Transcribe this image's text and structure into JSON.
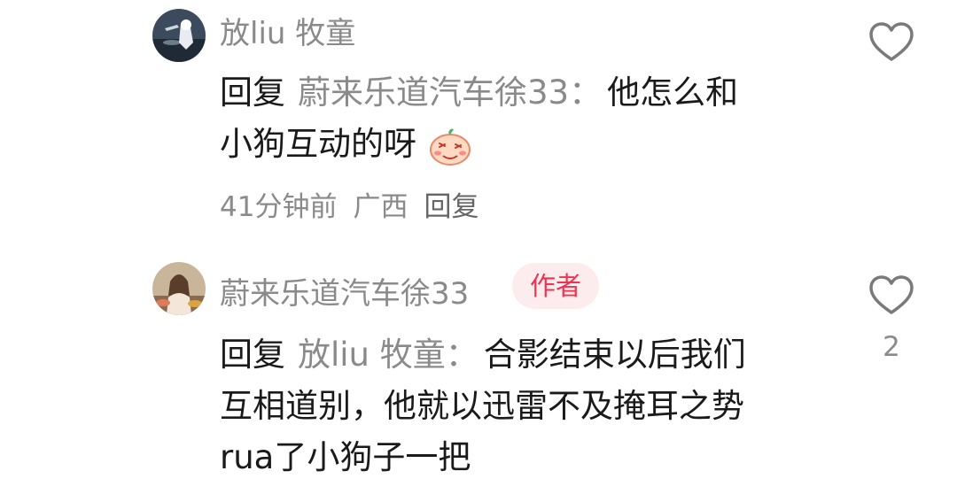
{
  "comments": [
    {
      "username": "放liu 牧童",
      "reply_word": "回复",
      "reply_target": "蔚来乐道汽车徐33",
      "colon": "：",
      "text_line1": "他怎么和",
      "text_line2": "小狗互动的呀",
      "emoji_icon": "shy-blush-emoji-icon",
      "time": "41分钟前",
      "location": "广西",
      "reply_label": "回复",
      "like_icon": "heart-outline-icon"
    },
    {
      "username": "蔚来乐道汽车徐33",
      "author_badge": "作者",
      "reply_word": "回复",
      "reply_target": "放liu 牧童",
      "colon": "：",
      "text_line1": "合影结束以后我们",
      "text_line2": "互相道别，他就以迅雷不及掩耳之势",
      "text_line3": "rua了小狗子一把",
      "like_icon": "heart-outline-icon",
      "like_count": "2"
    }
  ],
  "colors": {
    "username": "#8a8a8a",
    "text": "#1a1a1a",
    "author_badge_bg": "#fdecee",
    "author_badge_text": "#f0324e"
  }
}
